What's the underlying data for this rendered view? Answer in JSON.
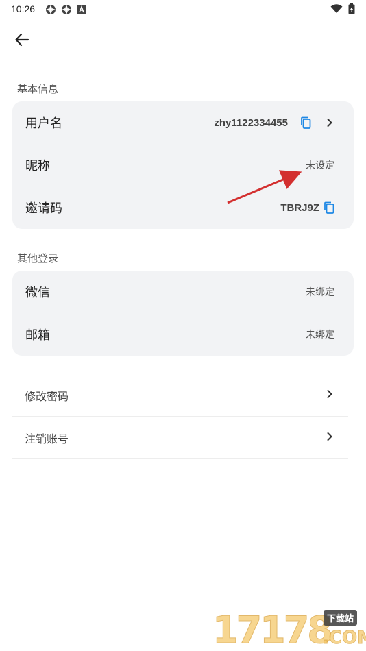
{
  "status_bar": {
    "time": "10:26",
    "left_icons": [
      "app-notification-icon",
      "app-notification-icon",
      "font-a-icon"
    ],
    "right_icons": [
      "wifi-icon",
      "battery-charging-icon"
    ]
  },
  "header": {
    "back_icon": "arrow-left-icon"
  },
  "basic_info": {
    "title": "基本信息",
    "username_label": "用户名",
    "username_value": "zhy1122334455",
    "nickname_label": "昵称",
    "nickname_value": "未设定",
    "invite_label": "邀请码",
    "invite_value": "TBRJ9Z"
  },
  "other_login": {
    "title": "其他登录",
    "wechat_label": "微信",
    "wechat_value": "未绑定",
    "email_label": "邮箱",
    "email_value": "未绑定"
  },
  "actions": {
    "change_password": "修改密码",
    "delete_account": "注销账号"
  },
  "watermark": {
    "digits": "17178",
    "badge": "下载站",
    "suffix": ".COM"
  },
  "colors": {
    "accent": "#1e88e5",
    "card_bg": "#f2f3f5",
    "annotation": "#d32f2f"
  }
}
